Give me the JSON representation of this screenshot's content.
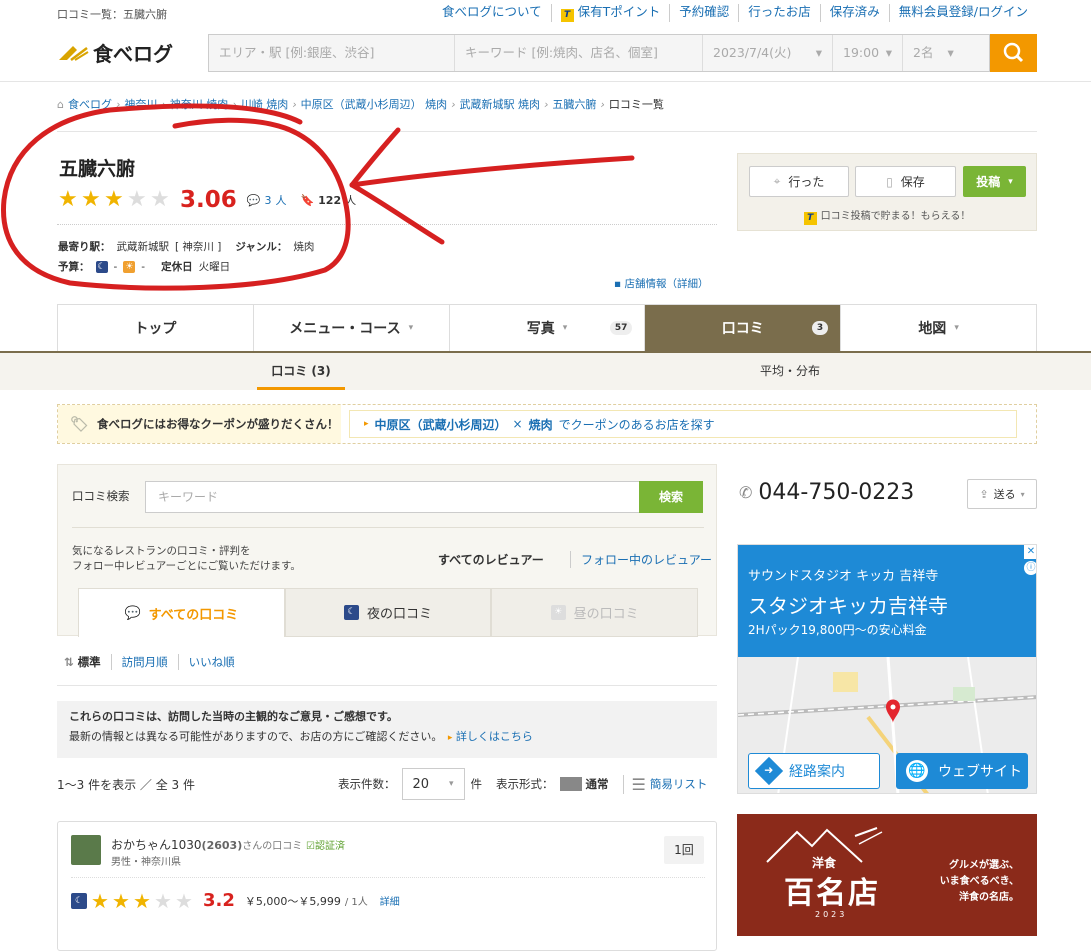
{
  "topbar": {
    "crumb": "口コミ一覧：五臓六腑",
    "links": [
      "食べログについて",
      "保有Tポイント",
      "予約確認",
      "行ったお店",
      "保存済み",
      "無料会員登録/ログイン"
    ]
  },
  "header": {
    "logo": "食べログ",
    "area_placeholder": "エリア・駅 [例:銀座、渋谷]",
    "keyword_placeholder": "キーワード [例:焼肉、店名、個室]",
    "date": "2023/7/4(火)",
    "time": "19:00",
    "people": "2名"
  },
  "breadcrumb": [
    "食べログ",
    "神奈川",
    "神奈川 焼肉",
    "川崎 焼肉",
    "中原区（武蔵小杉周辺） 焼肉",
    "武蔵新城駅 焼肉",
    "五臓六腑",
    "口コミ一覧"
  ],
  "restaurant": {
    "name": "五臓六腑",
    "rating": 3.06,
    "stars_filled": 3,
    "review_count": "3",
    "review_unit": "人",
    "saved_count": "122",
    "saved_unit": "人",
    "station_label": "最寄り駅：",
    "station": "武蔵新城駅",
    "pref": "[ 神奈川 ]",
    "genre_label": "ジャンル：",
    "genre": "焼肉",
    "budget_label": "予算：",
    "budget_night": "-",
    "budget_day": "-",
    "holiday_label": "定休日",
    "holiday": "火曜日",
    "shop_info": "店舗情報（詳細）"
  },
  "actions": {
    "went": "行った",
    "save": "保存",
    "post": "投稿",
    "note": "口コミ投稿で貯まる！もらえる！"
  },
  "tabs": [
    {
      "label": "トップ",
      "badge": ""
    },
    {
      "label": "メニュー・コース",
      "badge": ""
    },
    {
      "label": "写真",
      "badge": "57"
    },
    {
      "label": "口コミ",
      "badge": "3"
    },
    {
      "label": "地図",
      "badge": ""
    }
  ],
  "subtabs": {
    "reviews": "口コミ (3)",
    "average": "平均・分布"
  },
  "coupon": {
    "left": "食べログにはお得なクーポンが盛りだくさん！",
    "area": "中原区（武蔵小杉周辺）",
    "x": "×",
    "genre": "焼肉",
    "suffix": "でクーポンのあるお店を探す"
  },
  "review_search": {
    "label": "口コミ検索",
    "placeholder": "キーワード",
    "button": "検索",
    "desc1": "気になるレストランの口コミ・評判を",
    "desc2": "フォロー中レビュアーごとにご覧いただけます。",
    "all_reviewers": "すべてのレビュアー",
    "follow_reviewers": "フォロー中のレビュアー",
    "tabs": [
      "すべての口コミ",
      "夜の口コミ",
      "昼の口コミ"
    ]
  },
  "sort": [
    "標準",
    "訪問月順",
    "いいね順"
  ],
  "notice": {
    "line1": "これらの口コミは、訪問した当時の主観的なご意見・ご感想です。",
    "line2": "最新の情報とは異なる可能性がありますので、お店の方にご確認ください。",
    "link": "詳しくはこちら"
  },
  "listing": {
    "count_text": "1～3 件を表示 ／ 全 3 件",
    "per_page_label": "表示件数：",
    "per_page": "20",
    "per_page_unit": "件",
    "format_label": "表示形式：",
    "format_normal": "通常",
    "format_simple": "簡易リスト"
  },
  "review": {
    "user": "おかちゃん1030",
    "points": "(2603)",
    "suffix": "さんの口コミ",
    "verified": "認証済",
    "info": "男性・神奈川県",
    "visits": "1回",
    "score": "3.2",
    "stars_filled": 3,
    "price": "￥5,000～￥5,999",
    "per": "/ 1人",
    "detail": "詳細"
  },
  "sidebar": {
    "phone": "044-750-0223",
    "send": "送る",
    "ad1_line1": "サウンドスタジオ キッカ 吉祥寺",
    "ad1_line2": "スタジオキッカ吉祥寺",
    "ad1_line3": "2Hパック19,800円～の安心料金",
    "route": "経路案内",
    "website": "ウェブサイト",
    "ad2_sub": "洋食",
    "ad2_main": "百名店",
    "ad2_year": "2023",
    "ad2_r1": "グルメが選ぶ、",
    "ad2_r2": "いま食べるべき、",
    "ad2_r3": "洋食の名店。"
  },
  "colors": {
    "accent": "#f39800",
    "link": "#1a6fb3",
    "score": "#d8221e",
    "tab_active": "#7a6d4c",
    "green": "#7ab536",
    "annotation": "#d62020"
  }
}
